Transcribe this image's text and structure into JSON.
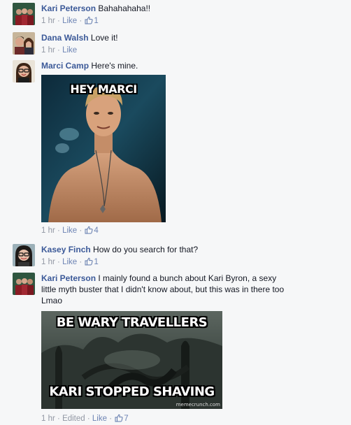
{
  "comments": [
    {
      "author": "Kari Peterson",
      "text": "Bahahahaha!!",
      "time": "1 hr",
      "like_label": "Like",
      "likes": "1"
    },
    {
      "author": "Dana Walsh",
      "text": "Love it!",
      "time": "1 hr",
      "like_label": "Like"
    },
    {
      "author": "Marci Camp",
      "text": "Here's mine.",
      "time": "1 hr",
      "like_label": "Like",
      "likes": "4",
      "meme_caption_top": "HEY MARCI"
    },
    {
      "author": "Kasey Finch",
      "text": "How do you search for that?",
      "time": "1 hr",
      "like_label": "Like",
      "likes": "1"
    },
    {
      "author": "Kari Peterson",
      "text": "I mainly found a bunch about Kari Byron, a sexy little myth buster that I didn't know about, but this was in there too Lmao",
      "time": "1 hr",
      "edited_label": "Edited",
      "like_label": "Like",
      "likes": "7",
      "meme_caption_top": "BE WARY TRAVELLERS",
      "meme_caption_bottom": "KARI STOPPED SHAVING",
      "meme_watermark": "memecrunch.com"
    }
  ],
  "separator": " · ",
  "icons": {
    "like": "thumbs-up-icon"
  },
  "colors": {
    "link": "#3b5998",
    "meta": "#9197a3",
    "background": "#f6f7f8"
  }
}
